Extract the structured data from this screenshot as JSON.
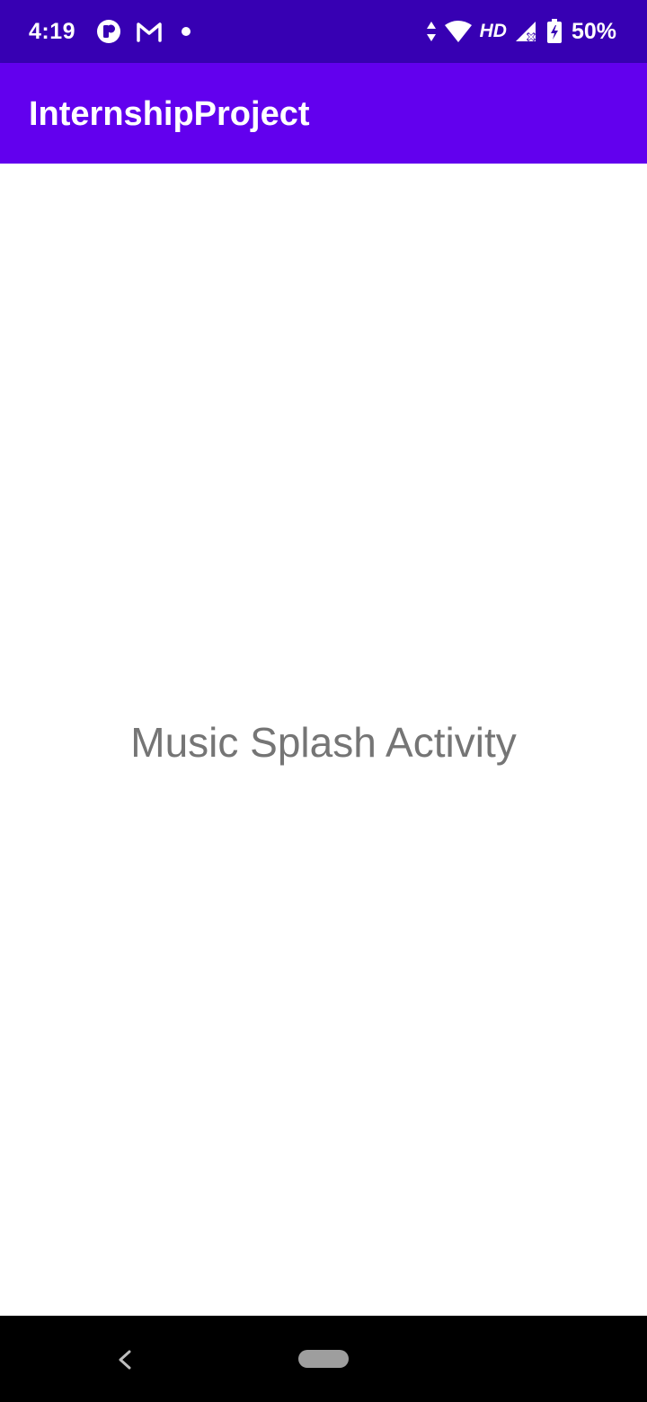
{
  "status_bar": {
    "time": "4:19",
    "network_label": "HD",
    "battery": "50%",
    "icons": [
      "app-notification-icon",
      "gmail-icon",
      "notification-dot-icon",
      "data-arrows-icon",
      "wifi-icon",
      "signal-icon",
      "battery-icon"
    ],
    "background_color": "#3700b3"
  },
  "app_bar": {
    "title": "InternshipProject",
    "background_color": "#6200ee"
  },
  "content": {
    "splash_text": "Music Splash Activity",
    "text_color": "#757575"
  },
  "nav_bar": {
    "icons": [
      "back-icon",
      "home-pill-icon"
    ]
  }
}
